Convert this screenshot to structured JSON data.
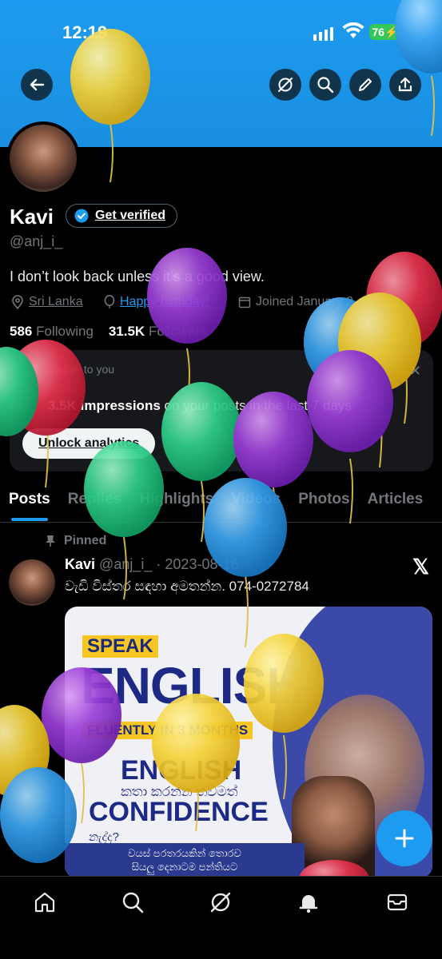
{
  "status_bar": {
    "time": "12:19",
    "battery": "76"
  },
  "profile": {
    "name": "Kavi",
    "get_verified": "Get verified",
    "handle": "@anj_i_",
    "bio": "I don’t look back unless it’s a good view.",
    "location": "Sri Lanka",
    "birthday": "Happy birthday!",
    "joined": "Joined January 2",
    "following_count": "586",
    "following_label": "Following",
    "followers_count": "31.5K",
    "followers_label": "Followers"
  },
  "analytics_card": {
    "label": "Visible to you",
    "impressions_count": "3.5K impressions",
    "impressions_text": "on your posts in the last 7 days",
    "unlock_button": "Unlock analytics"
  },
  "tabs": [
    "Posts",
    "Replies",
    "Highlights",
    "Videos",
    "Photos",
    "Articles"
  ],
  "pinned_post": {
    "pinned_label": "Pinned",
    "author": "Kavi",
    "handle": "@anj_i_",
    "date": "2023-08-16",
    "text": "වැඩි විස්තර සඳහා අමතන්න. 074-0272784",
    "x_logo": "𝕏",
    "media": {
      "speak": "SPEAK",
      "english_big": "ENGLISH",
      "fluently": "FLUENTLY IN 3 MONTHS",
      "english2": "ENGLISH",
      "sinhala1": "කතා කරන්න තවමත්",
      "confidence": "CONFIDENCE",
      "sinhala2": "නැද්ද?",
      "footer_line1": "වයස් පරතරයකින් තොරව",
      "footer_line2": "සියලු දෙනාටම පන්තියට"
    }
  },
  "nav": {
    "icons": [
      "home-icon",
      "search-icon",
      "grok-icon",
      "notifications-icon",
      "messages-icon"
    ]
  },
  "colors": {
    "banner": "#1d9bf0",
    "accent": "#1d9bf0",
    "background": "#000000",
    "muted": "#71767b"
  }
}
